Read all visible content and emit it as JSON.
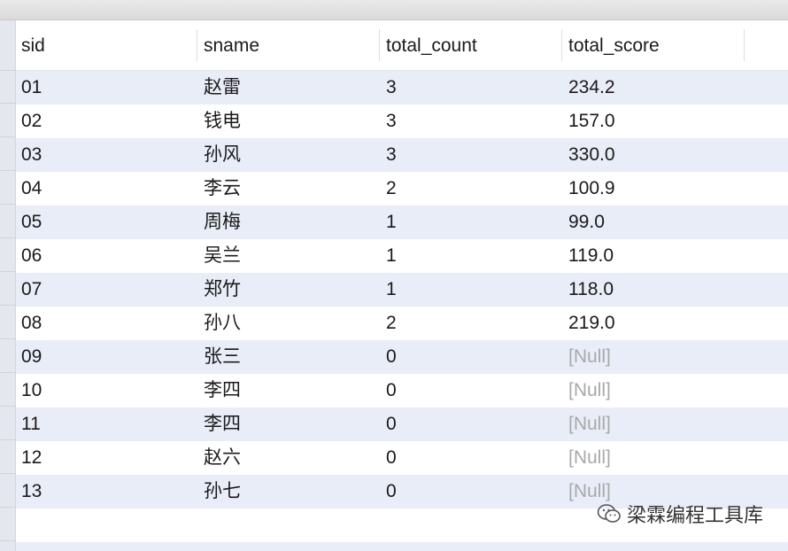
{
  "table": {
    "columns": [
      "sid",
      "sname",
      "total_count",
      "total_score"
    ],
    "rows": [
      [
        "01",
        "赵雷",
        "3",
        "234.2"
      ],
      [
        "02",
        "钱电",
        "3",
        "157.0"
      ],
      [
        "03",
        "孙风",
        "3",
        "330.0"
      ],
      [
        "04",
        "李云",
        "2",
        "100.9"
      ],
      [
        "05",
        "周梅",
        "1",
        "99.0"
      ],
      [
        "06",
        "吴兰",
        "1",
        "119.0"
      ],
      [
        "07",
        "郑竹",
        "1",
        "118.0"
      ],
      [
        "08",
        "孙八",
        "2",
        "219.0"
      ],
      [
        "09",
        "张三",
        "0",
        "[Null]"
      ],
      [
        "10",
        "李四",
        "0",
        "[Null]"
      ],
      [
        "11",
        "李四",
        "0",
        "[Null]"
      ],
      [
        "12",
        "赵六",
        "0",
        "[Null]"
      ],
      [
        "13",
        "孙七",
        "0",
        "[Null]"
      ]
    ],
    "null_token": "[Null]"
  },
  "watermark": {
    "icon": "wechat-icon",
    "text": "梁霖编程工具库"
  },
  "colors": {
    "row_stripe": "#e9edf7",
    "null_text": "#a9a9a9"
  }
}
